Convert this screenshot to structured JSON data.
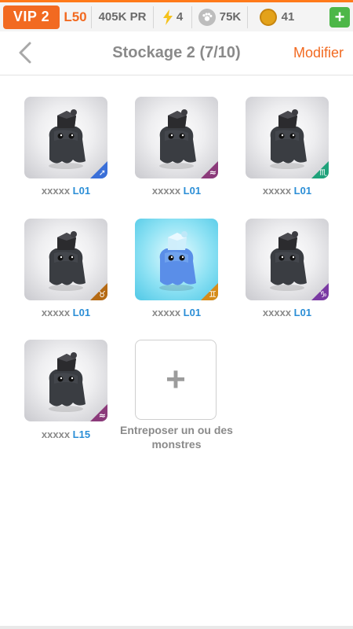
{
  "statusbar": {
    "vip": "VIP 2",
    "level": "L50",
    "power": "405K PR",
    "energy": "4",
    "food": "75K",
    "coins": "41"
  },
  "header": {
    "title": "Stockage 2 (7/10)",
    "modify": "Modifier"
  },
  "monsters": [
    {
      "name": "xxxxx",
      "level": "L01",
      "element_color": "#3a6fd8",
      "element_symbol": "➚"
    },
    {
      "name": "xxxxx",
      "level": "L01",
      "element_color": "#8b3a7a",
      "element_symbol": "≈"
    },
    {
      "name": "xxxxx",
      "level": "L01",
      "element_color": "#1fa27a",
      "element_symbol": "♏"
    },
    {
      "name": "xxxxx",
      "level": "L01",
      "element_color": "#b56a14",
      "element_symbol": "♉"
    },
    {
      "name": "xxxxx",
      "level": "L01",
      "element_color": "#d68b18",
      "element_symbol": "♊"
    },
    {
      "name": "xxxxx",
      "level": "L01",
      "element_color": "#7a3aa3",
      "element_symbol": "♑"
    },
    {
      "name": "xxxxx",
      "level": "L15",
      "element_color": "#8b3a7a",
      "element_symbol": "≈"
    }
  ],
  "add_slot": {
    "label": "Entreposer un ou des monstres"
  }
}
